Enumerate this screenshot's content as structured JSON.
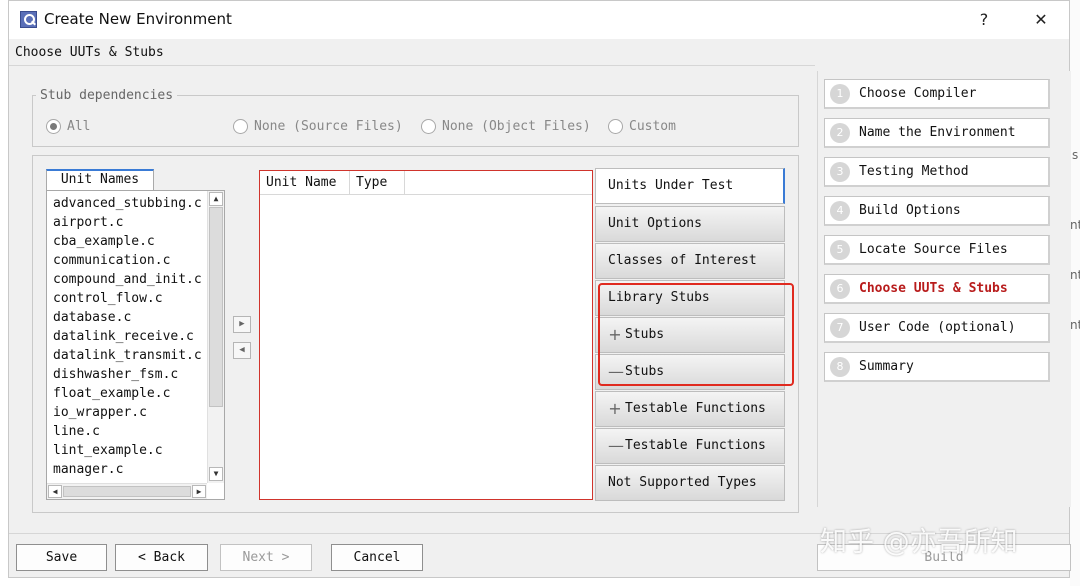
{
  "window": {
    "title": "Create New Environment",
    "help_label": "?",
    "close_label": "✕"
  },
  "page": {
    "subtitle": "Choose UUTs & Stubs"
  },
  "stub_dependencies": {
    "title": "Stub dependencies",
    "options": [
      {
        "label": "All",
        "selected": true
      },
      {
        "label": "None (Source Files)",
        "selected": false
      },
      {
        "label": "None (Object Files)",
        "selected": false
      },
      {
        "label": "Custom",
        "selected": false
      }
    ]
  },
  "unit_names": {
    "tab_label": "Unit Names",
    "items": [
      "advanced_stubbing.c",
      "airport.c",
      "cba_example.c",
      "communication.c",
      "compound_and_init.c",
      "control_flow.c",
      "database.c",
      "datalink_receive.c",
      "datalink_transmit.c",
      "dishwasher_fsm.c",
      "float_example.c",
      "io_wrapper.c",
      "line.c",
      "lint_example.c",
      "manager.c"
    ]
  },
  "table": {
    "columns": [
      "Unit Name",
      "Type"
    ]
  },
  "side_tabs": [
    {
      "label": "Units Under Test",
      "symbol": "",
      "active": true
    },
    {
      "label": "Unit Options",
      "symbol": ""
    },
    {
      "label": "Classes of Interest",
      "symbol": ""
    },
    {
      "label": "Library Stubs",
      "symbol": ""
    },
    {
      "label": "Stubs",
      "symbol": "+"
    },
    {
      "label": "Stubs",
      "symbol": "—"
    },
    {
      "label": "Testable Functions",
      "symbol": "+"
    },
    {
      "label": "Testable Functions",
      "symbol": "—"
    },
    {
      "label": "Not Supported Types",
      "symbol": ""
    }
  ],
  "wizard_steps": [
    {
      "number": "1",
      "label": "Choose Compiler"
    },
    {
      "number": "2",
      "label": "Name the Environment"
    },
    {
      "number": "3",
      "label": "Testing Method"
    },
    {
      "number": "4",
      "label": "Build Options"
    },
    {
      "number": "5",
      "label": "Locate Source Files"
    },
    {
      "number": "6",
      "label": "Choose UUTs & Stubs",
      "current": true
    },
    {
      "number": "7",
      "label": "User Code (optional)"
    },
    {
      "number": "8",
      "label": "Summary"
    }
  ],
  "buttons": {
    "save": "Save",
    "back": "< Back",
    "next": "Next >",
    "cancel": "Cancel",
    "build": "Build"
  },
  "watermark": "知乎 @亦吾所知",
  "background_fragments": [
    "s",
    "nt",
    "nt",
    "nt"
  ],
  "colors": {
    "highlight": "#e02a1f",
    "current_step": "#b81c1c",
    "table_border": "#d0342c",
    "active_tab_accent": "#3a7bd5"
  }
}
